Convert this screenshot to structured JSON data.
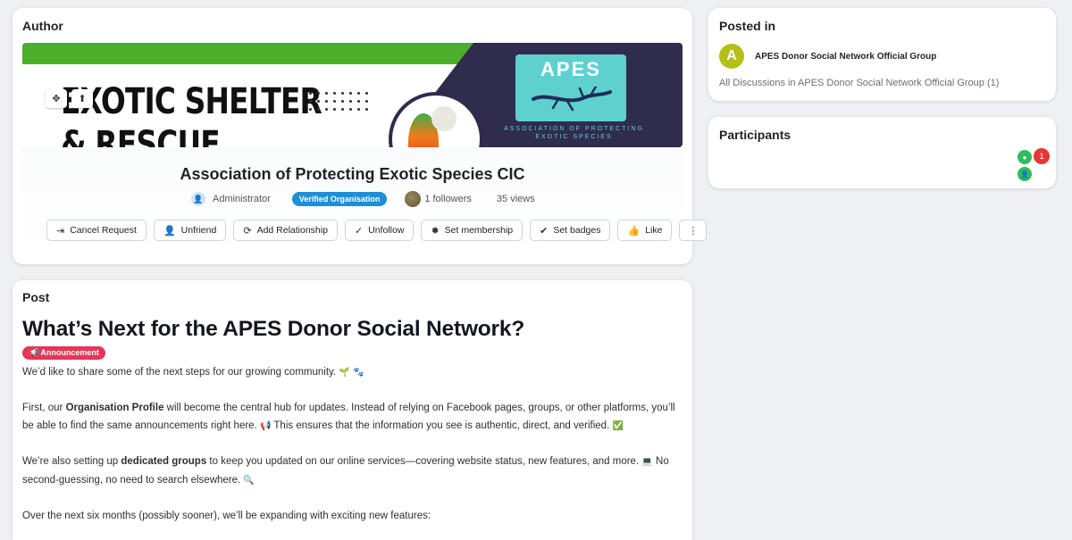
{
  "author": {
    "card_title": "Author",
    "cover": {
      "headline": "EXOTIC SHELTER",
      "headline2": "& RESCUE",
      "logo_text": "APES",
      "logo_subtitle": "ASSOCIATION OF PROTECTING EXOTIC SPECIES"
    },
    "org_name": "Association of Protecting Exotic Species CIC",
    "role": "Administrator",
    "verified_badge": "Verified Organisation",
    "followers": "1 followers",
    "views": "35 views",
    "actions": [
      {
        "label": "Cancel Request",
        "icon": "sign-out-icon"
      },
      {
        "label": "Unfriend",
        "icon": "user-minus-icon"
      },
      {
        "label": "Add Relationship",
        "icon": "refresh-icon"
      },
      {
        "label": "Unfollow",
        "icon": "check-icon"
      },
      {
        "label": "Set membership",
        "icon": "badge-icon"
      },
      {
        "label": "Set badges",
        "icon": "check-circle-icon"
      },
      {
        "label": "Like",
        "icon": "thumbs-up-icon"
      }
    ]
  },
  "post": {
    "card_title": "Post",
    "title": "What’s Next for the APES Donor Social Network?",
    "tag": "Announcement",
    "p1": "We’d like to share some of the next steps for our growing community.",
    "p2_a": "First, our ",
    "p2_bold": "Organisation Profile",
    "p2_b": " will become the central hub for updates. Instead of relying on Facebook pages, groups, or other platforms, you’ll be able to find the same announcements right here.",
    "p2_c": " This ensures that the information you see is authentic, direct, and verified.",
    "p3_a": "We’re also setting up ",
    "p3_bold": "dedicated groups",
    "p3_b": " to keep you updated on our online services—covering website status, new features, and more.",
    "p3_c": " No second-guessing, no need to search elsewhere.",
    "p4": "Over the next six months (possibly sooner), we’ll be expanding with exciting new features:"
  },
  "posted_in": {
    "card_title": "Posted in",
    "avatar_letter": "A",
    "group_name": "APES Donor Social Network Official Group",
    "discussions": "All Discussions in APES Donor Social Network Official Group (1)"
  },
  "participants": {
    "card_title": "Participants",
    "count_badge": "1"
  }
}
